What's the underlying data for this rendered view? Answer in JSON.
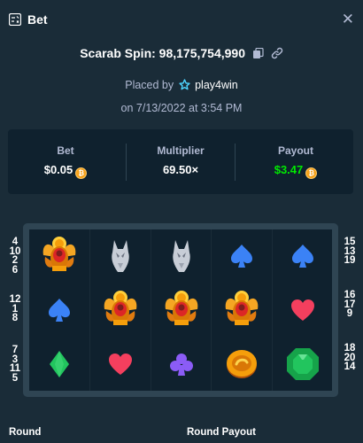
{
  "header": {
    "title": "Bet",
    "icon": "bet-receipt-icon",
    "close_icon": "close-icon",
    "close_glyph": "✕"
  },
  "spin": {
    "label": "Scarab Spin: 98,175,754,990",
    "copy_icon": "copy-icon",
    "link_icon": "link-icon"
  },
  "placed": {
    "prefix": "Placed by",
    "user": "play4win",
    "user_icon": "star-icon",
    "date": "on 7/13/2022 at 3:54 PM"
  },
  "stats": [
    {
      "label": "Bet",
      "value": "$0.05",
      "currency_icon": "bitcoin-icon",
      "color": "#ffffff"
    },
    {
      "label": "Multiplier",
      "value": "69.50×",
      "color": "#ffffff"
    },
    {
      "label": "Payout",
      "value": "$3.47",
      "currency_icon": "bitcoin-icon",
      "color": "#00e701"
    }
  ],
  "paylines": {
    "left": [
      [
        "4",
        "10",
        "2",
        "6"
      ],
      [
        "12",
        "1",
        "8"
      ],
      [
        "7",
        "3",
        "11",
        "5"
      ]
    ],
    "right": [
      [
        "15",
        "13",
        "19"
      ],
      [
        "16",
        "17",
        "9"
      ],
      [
        "18",
        "20",
        "14"
      ]
    ]
  },
  "board": {
    "columns": [
      [
        "scarab",
        "spade",
        "diamond"
      ],
      [
        "wolf",
        "scarab",
        "heart"
      ],
      [
        "wolf",
        "scarab",
        "club"
      ],
      [
        "spade",
        "scarab",
        "coin"
      ],
      [
        "spade",
        "heart",
        "emerald"
      ]
    ]
  },
  "footer": {
    "round_label": "Round",
    "round_payout_label": "Round Payout"
  }
}
